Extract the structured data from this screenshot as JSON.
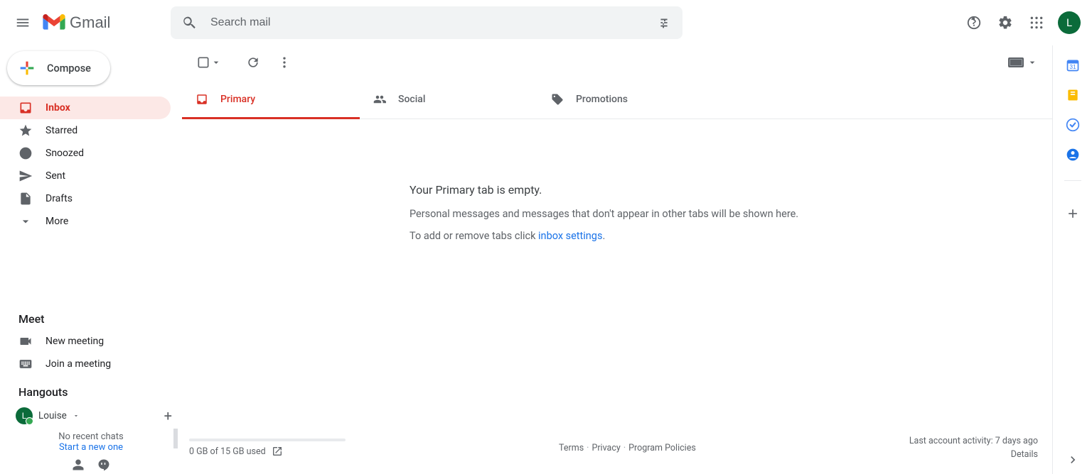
{
  "header": {
    "product": "Gmail",
    "search_placeholder": "Search mail",
    "avatar_initial": "L"
  },
  "compose_label": "Compose",
  "nav": {
    "inbox": "Inbox",
    "starred": "Starred",
    "snoozed": "Snoozed",
    "sent": "Sent",
    "drafts": "Drafts",
    "more": "More"
  },
  "meet": {
    "title": "Meet",
    "new_meeting": "New meeting",
    "join_meeting": "Join a meeting"
  },
  "hangouts": {
    "title": "Hangouts",
    "user": "Louise",
    "av_initial": "L",
    "empty_line1": "No recent chats",
    "empty_line2": "Start a new one"
  },
  "tabs": {
    "primary": "Primary",
    "social": "Social",
    "promotions": "Promotions"
  },
  "empty_state": {
    "line1": "Your Primary tab is empty.",
    "line2": "Personal messages and messages that don't appear in other tabs will be shown here.",
    "line3_pre": "To add or remove tabs click ",
    "line3_link": "inbox settings",
    "line3_post": "."
  },
  "footer": {
    "storage": "0 GB of 15 GB used",
    "terms": "Terms",
    "privacy": "Privacy",
    "policies": "Program Policies",
    "activity": "Last account activity: 7 days ago",
    "details": "Details"
  }
}
